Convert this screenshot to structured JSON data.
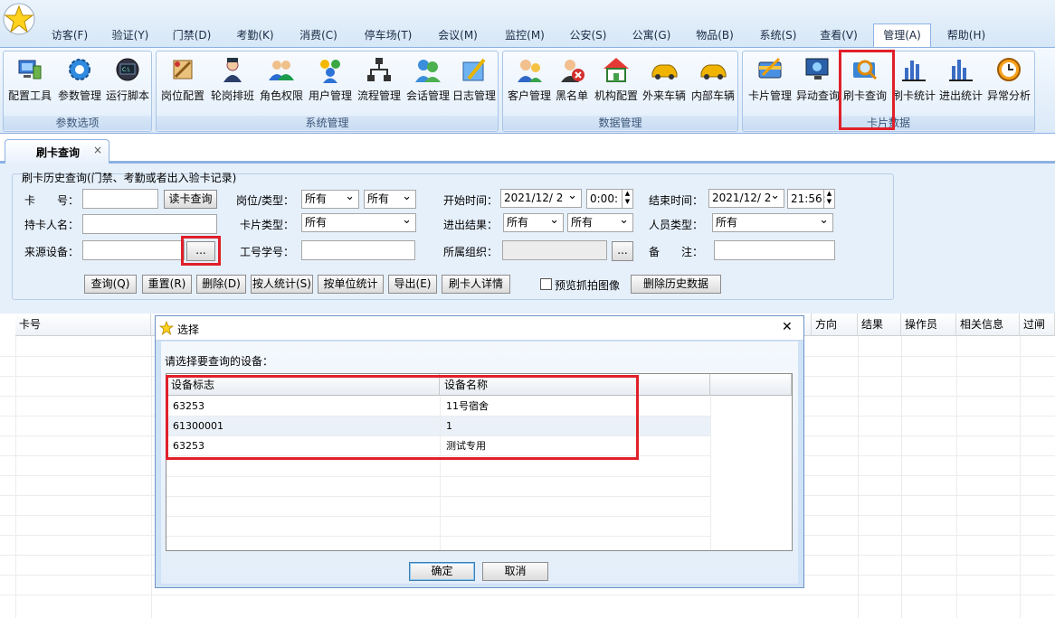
{
  "menu": {
    "tabs": [
      "访客(F)",
      "验证(Y)",
      "门禁(D)",
      "考勤(K)",
      "消费(C)",
      "停车场(T)",
      "会议(M)",
      "监控(M)",
      "公安(S)",
      "公寓(G)",
      "物品(B)",
      "系统(S)",
      "查看(V)",
      "管理(A)",
      "帮助(H)"
    ],
    "active": "管理(A)"
  },
  "ribbon": {
    "groups": [
      {
        "label": "参数选项",
        "buttons": [
          "配置工具",
          "参数管理",
          "运行脚本"
        ]
      },
      {
        "label": "系统管理",
        "buttons": [
          "岗位配置",
          "轮岗排班",
          "角色权限",
          "用户管理",
          "流程管理",
          "会话管理",
          "日志管理"
        ]
      },
      {
        "label": "数据管理",
        "buttons": [
          "客户管理",
          "黑名单",
          "机构配置",
          "外来车辆",
          "内部车辆"
        ]
      },
      {
        "label": "卡片数据",
        "buttons": [
          "卡片管理",
          "异动查询",
          "刷卡查询",
          "刷卡统计",
          "进出统计",
          "异常分析"
        ]
      }
    ]
  },
  "doc_tab": {
    "label": "刷卡查询",
    "close": "×"
  },
  "query": {
    "legend": "刷卡历史查询(门禁、考勤或者出入验卡记录)",
    "card_no_label": "卡　　号：",
    "read_card_btn": "读卡查询",
    "post_type_label": "岗位/类型：",
    "post_value": "所有",
    "type_value": "所有",
    "start_time_label": "开始时间：",
    "start_date": "2021/12/ 2",
    "start_time": "0:00:",
    "end_time_label": "结束时间：",
    "end_date": "2021/12/ 2",
    "end_time": "21:56:",
    "holder_label": "持卡人名：",
    "card_type_label": "卡片类型：",
    "card_type_value": "所有",
    "io_result_label": "进出结果：",
    "io_result_value1": "所有",
    "io_result_value2": "所有",
    "person_type_label": "人员类型：",
    "person_type_value": "所有",
    "source_device_label": "来源设备：",
    "browse_btn": "...",
    "staff_no_label": "工号学号：",
    "org_label": "所属组织：",
    "org_browse_btn": "...",
    "remark_label": "备　　注：",
    "buttons": [
      "查询(Q)",
      "重置(R)",
      "删除(D)",
      "按人统计(S)",
      "按单位统计",
      "导出(E)",
      "刷卡人详情"
    ],
    "preview_checkbox": "预览抓拍图像",
    "delete_history_btn": "删除历史数据"
  },
  "grid": {
    "columns_left": [
      "卡号"
    ],
    "columns_right": [
      "方向",
      "结果",
      "操作员",
      "相关信息",
      "过闸"
    ]
  },
  "dialog": {
    "title": "选择",
    "close": "✕",
    "prompt": "请选择要查询的设备：",
    "columns": [
      "设备标志",
      "设备名称"
    ],
    "rows": [
      {
        "id": "63253",
        "name": "11号宿舍"
      },
      {
        "id": "61300001",
        "name": "1"
      },
      {
        "id": "63253",
        "name": "测试专用"
      }
    ],
    "ok_btn": "确定",
    "cancel_btn": "取消"
  },
  "colors": {
    "accent": "#8db2e3",
    "highlight": "#e0202a",
    "selection": "#cde4fb"
  }
}
